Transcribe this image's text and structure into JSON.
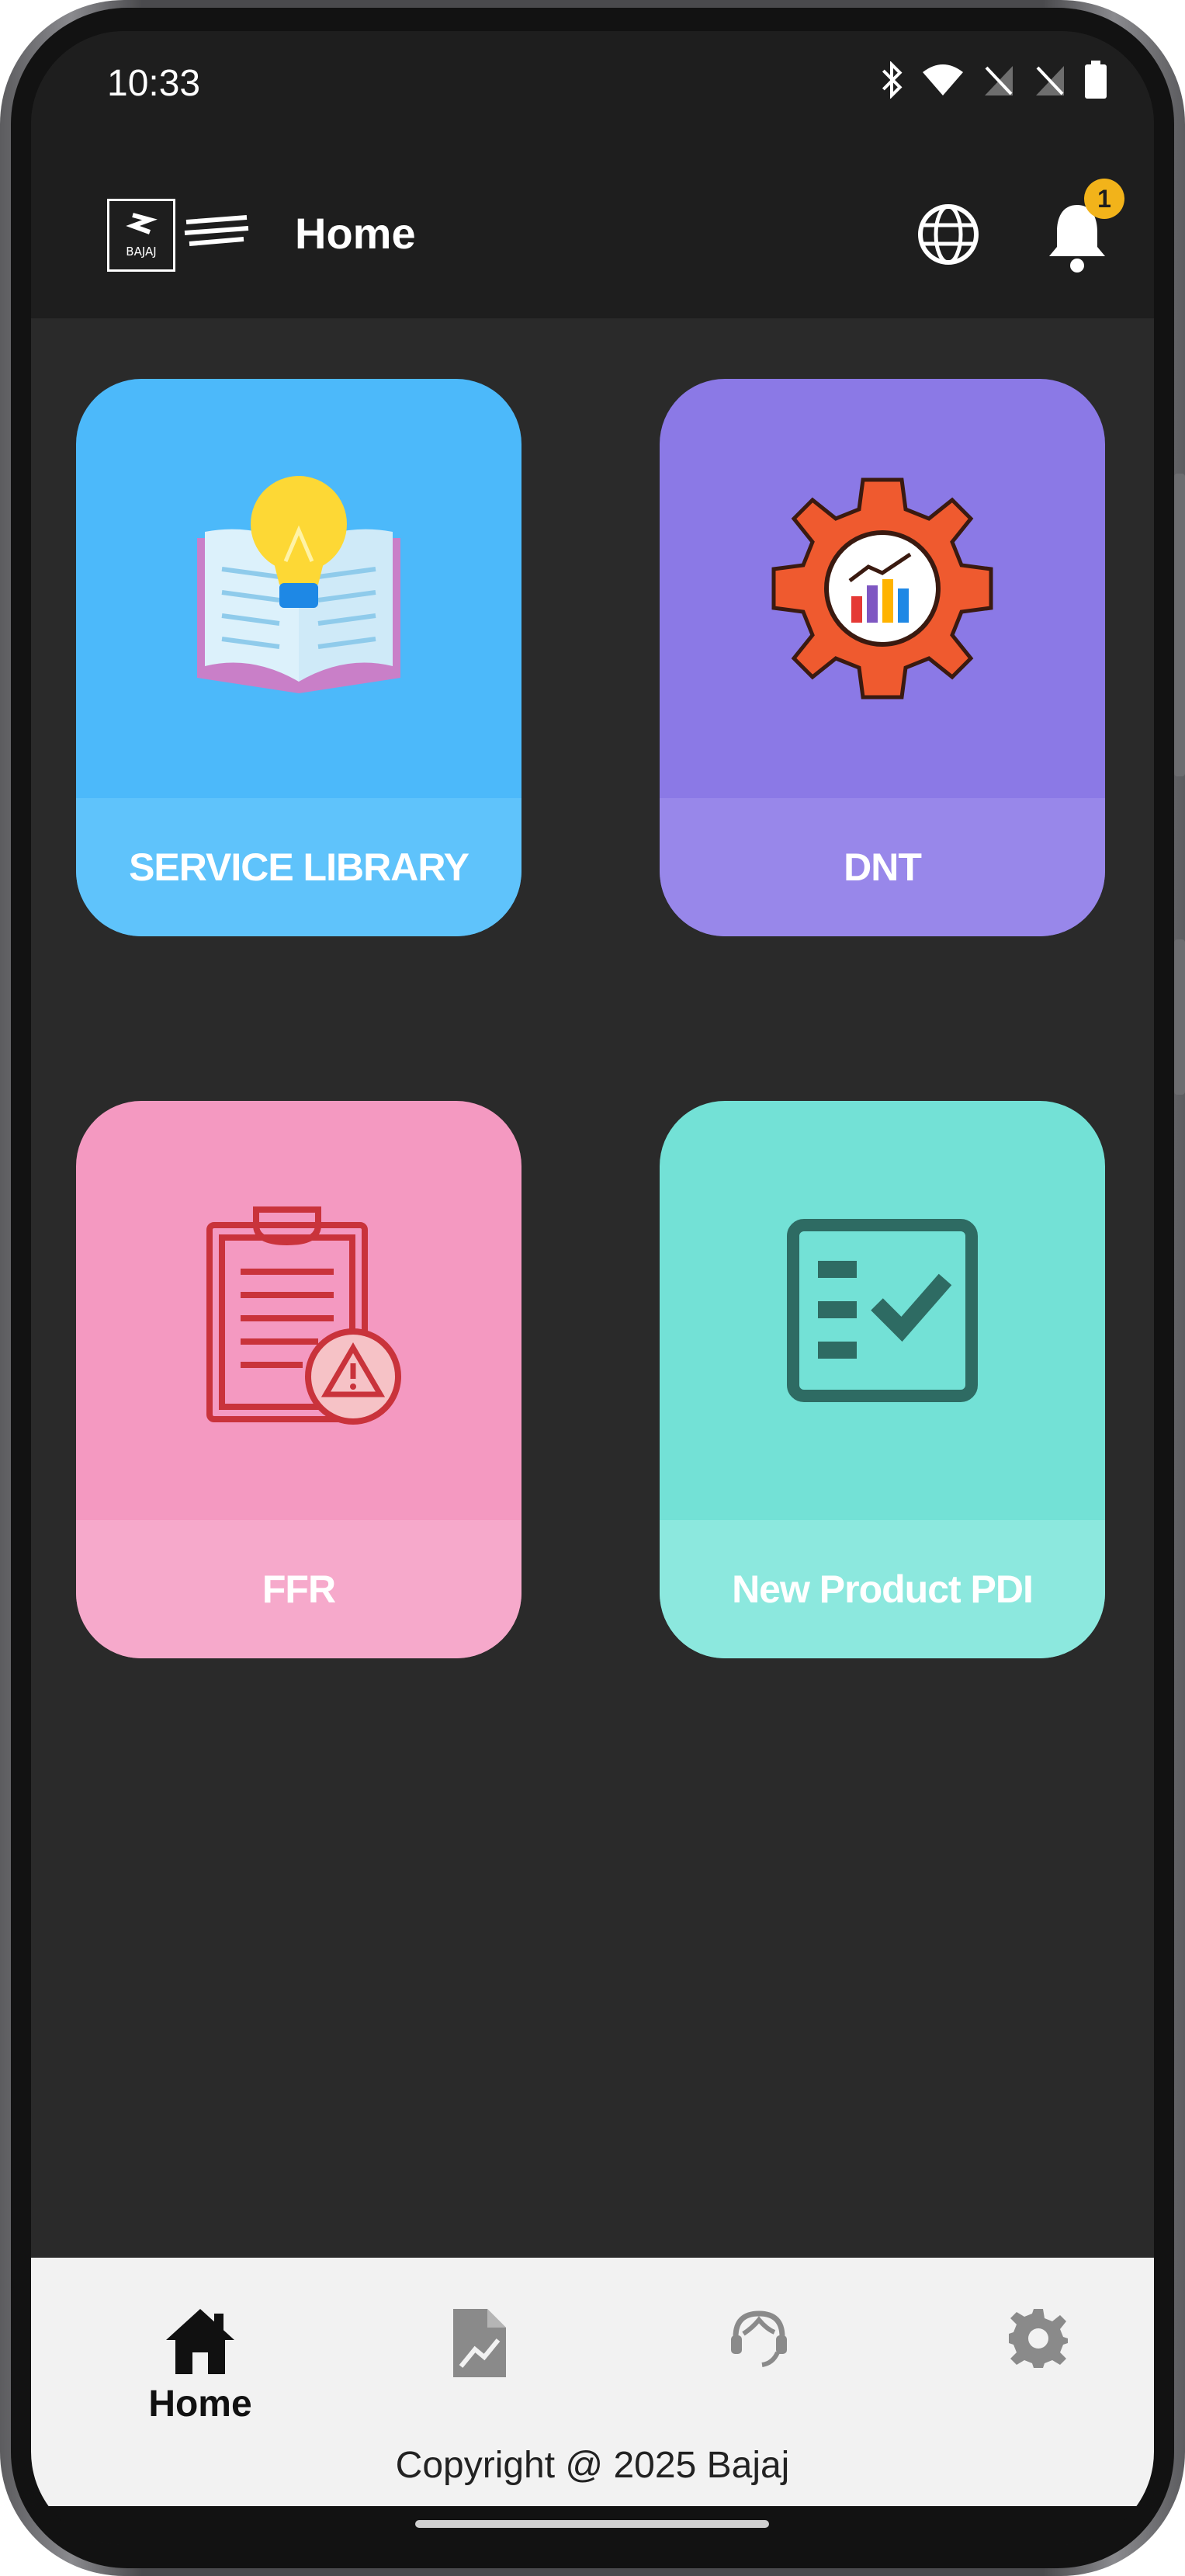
{
  "status_bar": {
    "time": "10:33"
  },
  "app_bar": {
    "title": "Home",
    "notification_count": "1"
  },
  "tiles": [
    {
      "label": "SERVICE LIBRARY",
      "icon": "book-lightbulb-icon",
      "bg": "#4cb9fa",
      "label_bg": "#5fc3fb"
    },
    {
      "label": "DNT",
      "icon": "gear-chart-icon",
      "bg": "#8b79e6",
      "label_bg": "#9887ea"
    },
    {
      "label": "FFR",
      "icon": "clipboard-warning-icon",
      "bg": "#f499c1",
      "label_bg": "#f6a9cb"
    },
    {
      "label": "New Product PDI",
      "icon": "checklist-icon",
      "bg": "#73e1d6",
      "label_bg": "#8ce8de"
    }
  ],
  "bottom_nav": {
    "items": [
      {
        "label": "Home",
        "icon": "home-icon",
        "active": true
      },
      {
        "label": "",
        "icon": "report-icon",
        "active": false
      },
      {
        "label": "",
        "icon": "support-agent-icon",
        "active": false
      },
      {
        "label": "",
        "icon": "settings-gear-icon",
        "active": false
      }
    ],
    "copyright": "Copyright @ 2025 Bajaj"
  },
  "colors": {
    "background": "#2a2a2a",
    "appbar": "#1e1e1e",
    "nav_bg": "#f2f2f2",
    "badge": "#f2b31a"
  }
}
